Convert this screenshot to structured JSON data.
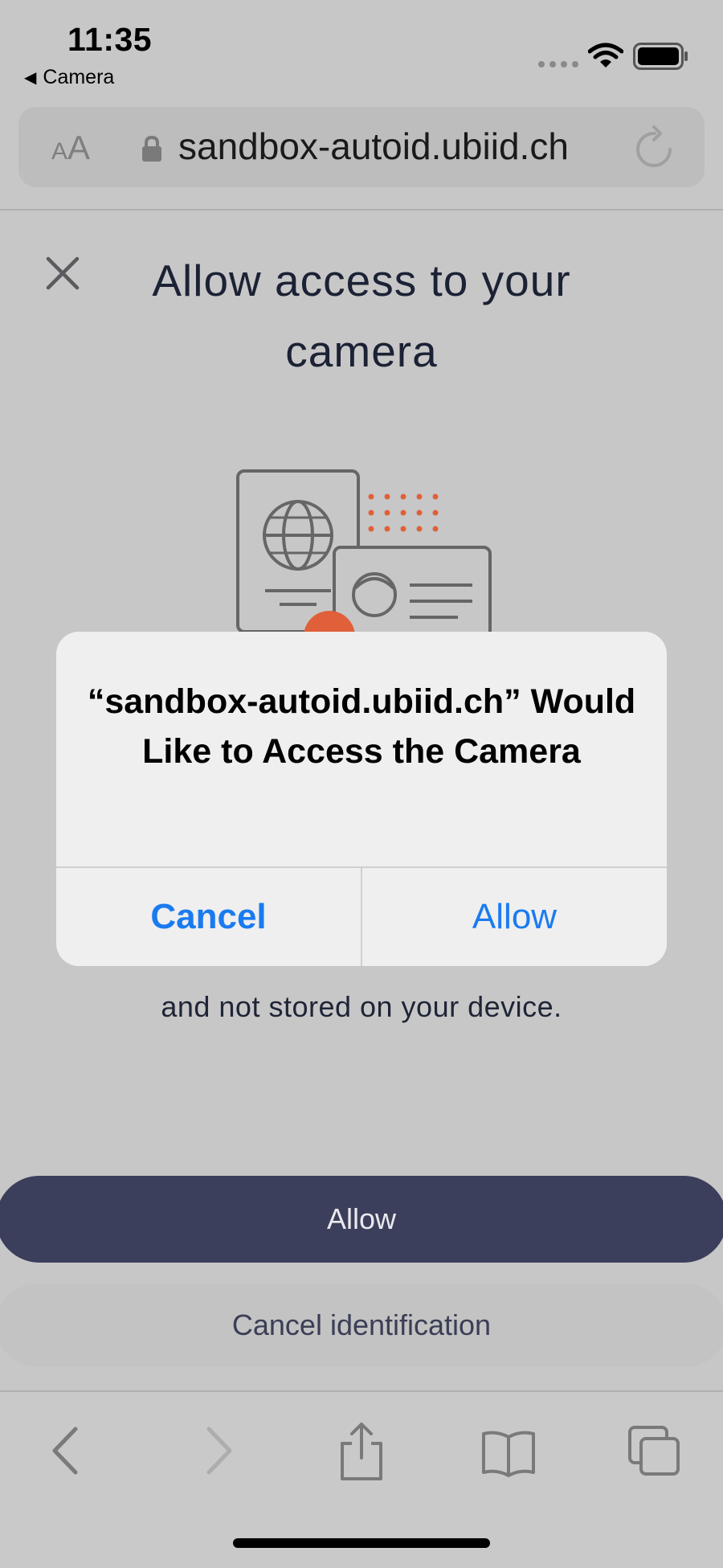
{
  "status_bar": {
    "time": "11:35",
    "back_app": "Camera"
  },
  "address_bar": {
    "text_size_label": "AA",
    "url": "sandbox-autoid.ubiid.ch"
  },
  "page": {
    "title": "Allow access to your camera",
    "body_text": "and not stored on your device.",
    "allow_button": "Allow",
    "cancel_button": "Cancel identification"
  },
  "dialog": {
    "title": "“sandbox-autoid.ubiid.ch” Would Like to Access the Camera",
    "cancel_label": "Cancel",
    "allow_label": "Allow"
  },
  "colors": {
    "accent": "#1a7bf0",
    "primary_button": "#3c3f5b",
    "illustration_accent": "#e0603a"
  }
}
